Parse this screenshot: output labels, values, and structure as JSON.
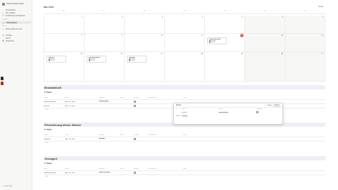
{
  "sidebar": {
    "workspace": "Unsere Notion Lizenz",
    "items": [
      {
        "icon": "search-icon",
        "glyph": "⌕",
        "label": "Schnellsuche"
      },
      {
        "icon": "clock-icon",
        "glyph": "◷",
        "label": "Alle Updates"
      },
      {
        "icon": "gear-icon",
        "glyph": "⚙",
        "label": "Einstellungen & Mitglieder"
      }
    ],
    "favorites_label": "Favoriten",
    "active_page": "Haushaltsplan",
    "private_label": "Privat",
    "private_items": [
      "Wöchentliche Termine"
    ],
    "lower_items": [
      "Vorlagen",
      "Import",
      "Papierkorb"
    ],
    "new_page": "Neue Seite"
  },
  "calendar": {
    "month": "März 2021",
    "today_button": "Heute",
    "weekdays": [
      "Mo",
      "Di",
      "Mi",
      "Do",
      "Fr",
      "Sa",
      "So"
    ],
    "days": [
      "1",
      "2",
      "3",
      "4",
      "5",
      "6",
      "7",
      "8",
      "9",
      "10",
      "11",
      "12",
      "13",
      "14",
      "15",
      "16",
      "17",
      "18",
      "19",
      "20",
      "21"
    ],
    "today_index": 11,
    "cards": [
      {
        "cell": 11,
        "title": "Geburtstag Anna",
        "lines": [
          "Erledigt",
          "Einkauf"
        ]
      },
      {
        "cell": 15,
        "title": "Müll rausbringen",
        "lines": [
          "Erledigt",
          "Einkauf"
        ]
      },
      {
        "cell": 16,
        "title": "Hausputz",
        "lines": [
          "Erledigt",
          "Einkauf"
        ]
      },
      {
        "cell": 14,
        "title": "Wäsche",
        "lines": [
          "Erledigt",
          "Einkauf"
        ]
      }
    ]
  },
  "sections": {
    "s1_title": "Brandaktuell",
    "s2_title": "Priorisierung dieser Woche",
    "s3_title": "Verzögert",
    "tasks_label": "Tasks",
    "columns": [
      "Name",
      "Datum",
      "Kategorie",
      "Status",
      "Erledigt",
      "Verantwortlich",
      "Notiz"
    ],
    "s1_rows": [
      {
        "name": "Geburtstag Anna",
        "date": "März 12, 2021",
        "tag": "Wöchentlich"
      },
      {
        "name": "Wäsche",
        "date": "März 15, 2021",
        "tag": ""
      }
    ],
    "s2_rows": [
      {
        "name": "Hausputz",
        "date": "März 16, 2021",
        "tag": "Einkauf"
      }
    ],
    "s3_rows": [
      {
        "name": "Geburtstag Anna",
        "date": "März 12, 2021",
        "tag": "März 12, 2021"
      }
    ],
    "new_row": "+ Neu"
  },
  "popup": {
    "title": "Woche",
    "link": "Öffnen",
    "share": "Teilen",
    "columns": [
      "Name",
      "Woche",
      "Kategorie",
      "Status"
    ],
    "row_name": "Woche",
    "row_tag": "Wöchentlich",
    "sub": "Einkauf",
    "sub_tag": "Erledigt"
  }
}
